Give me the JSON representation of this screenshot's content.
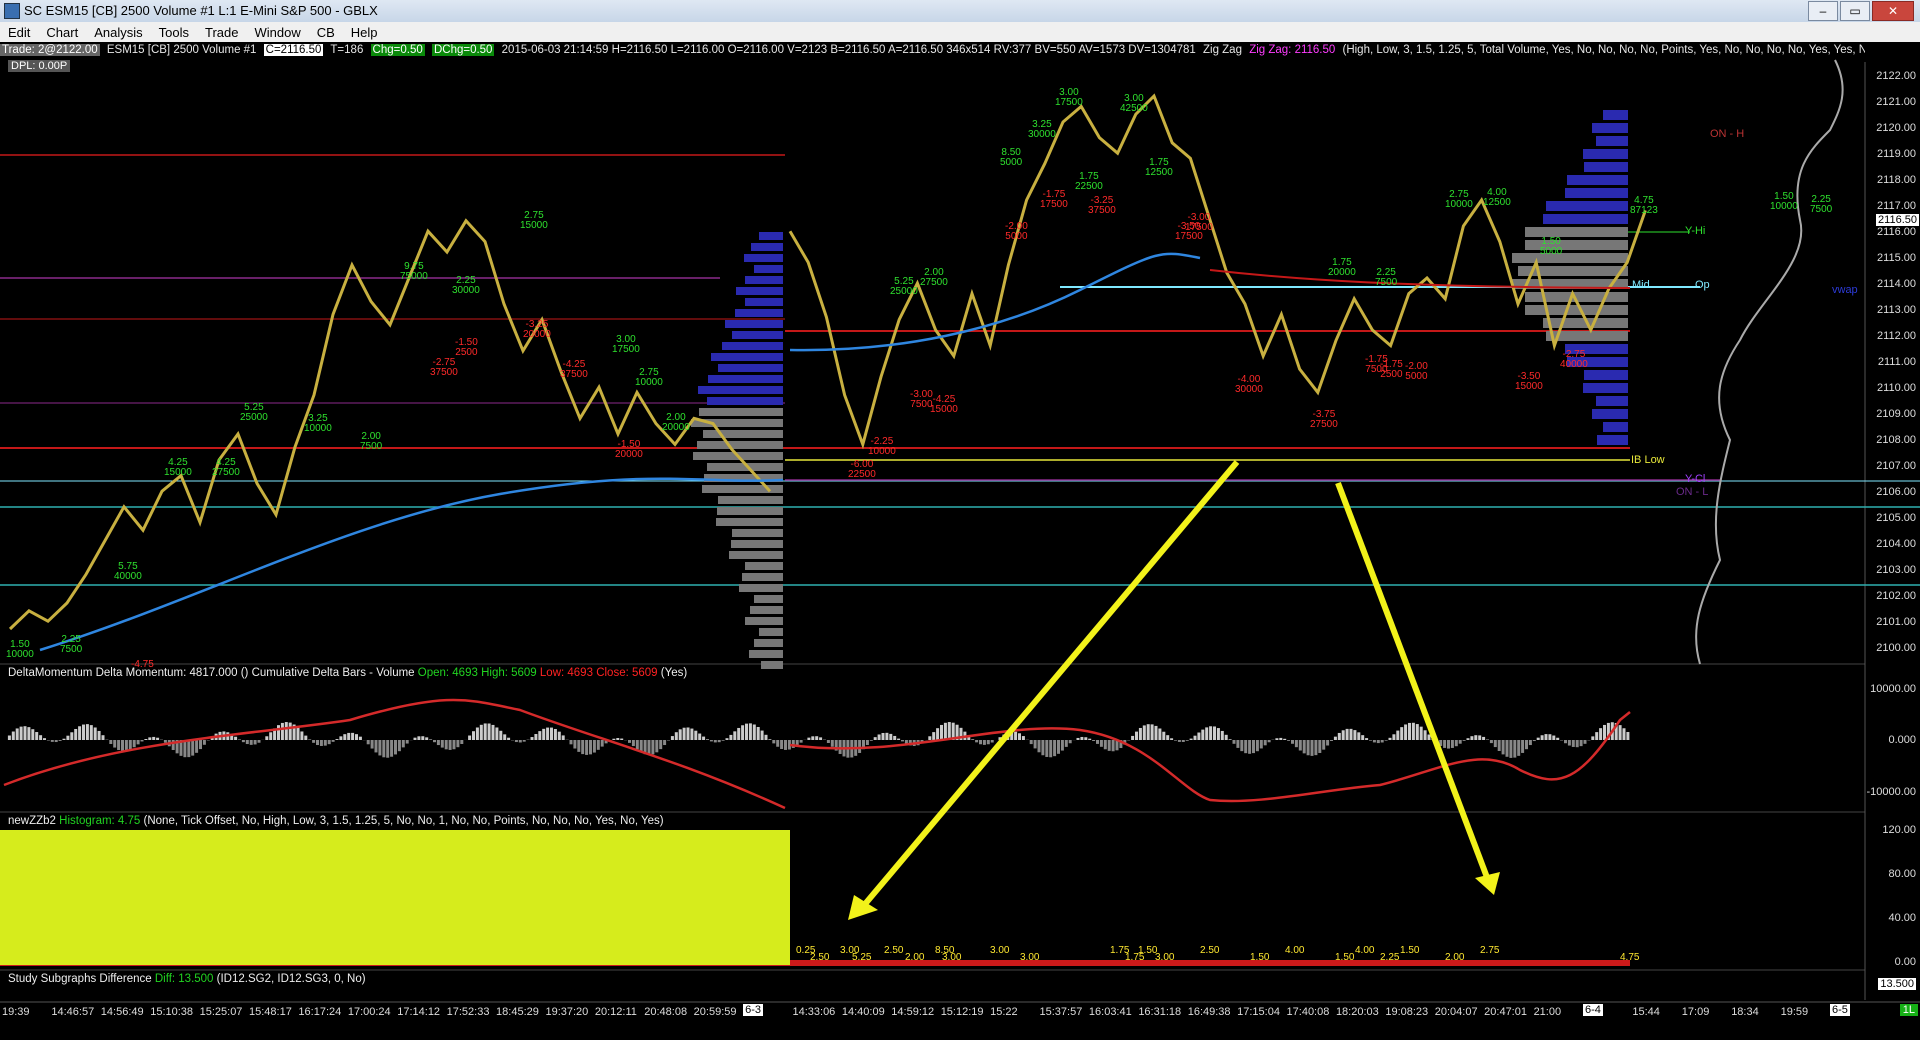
{
  "window": {
    "title": "SC ESM15 [CB]  2500 Volume  #1  L:1  E-Mini S&P 500 - GBLX",
    "controls": [
      "–",
      "▭",
      "✕"
    ]
  },
  "menu": [
    "Edit",
    "Chart",
    "Analysis",
    "Tools",
    "Trade",
    "Window",
    "CB",
    "Help"
  ],
  "infobar": {
    "trade": "Trade: 2@2122.00",
    "symbol": "ESM15 [CB]  2500 Volume  #1",
    "close": "C=2116.50",
    "ticks": "T=186",
    "chg": "Chg=0.50",
    "dchg": "DChg=0.50",
    "stats": "2015-06-03 21:14:59 H=2116.50 L=2116.00 O=2116.00 V=2123 B=2116.50 A=2116.50 346x514 RV:377 BV=550 AV=1573 DV=1304781",
    "zz1": "Zig Zag",
    "zz2": "Zig Zag: 2116.50",
    "zz3": "(High, Low, 3, 1.5, 1.25, 5, Total Volume, Yes, No, No, No, No, Points, Yes, No, No, No, No, Yes, Yes, No, Percent",
    "dpl": "DPL: 0.00P"
  },
  "price_axis": {
    "labels": [
      "2122.00",
      "2121.00",
      "2120.00",
      "2119.00",
      "2118.00",
      "2117.00",
      "2116.00",
      "2115.00",
      "2114.00",
      "2113.00",
      "2112.00",
      "2111.00",
      "2110.00",
      "2109.00",
      "2108.00",
      "2107.00",
      "2106.00",
      "2105.00",
      "2104.00",
      "2103.00",
      "2102.00",
      "2101.00",
      "2100.00"
    ],
    "current_price": "2116.50"
  },
  "levels": {
    "on_h": "ON - H",
    "y_hi": "Y-Hi",
    "mid": "Mid",
    "op": "Op",
    "ib_low": "IB Low",
    "y_cl": "Y-Cl",
    "on_l": "ON - L",
    "vwap": "vwap"
  },
  "delta_panel": {
    "name": "DeltaMomentum",
    "value": "Delta Momentum: 4817.000",
    "paren": "()",
    "cum": "Cumulative Delta Bars - Volume",
    "open": "Open: 4693",
    "high": "High: 5609",
    "low": "Low: 4693",
    "close": "Close: 5609",
    "yes": "(Yes)",
    "axis": [
      "10000.00",
      "0.000",
      "-10000.00"
    ]
  },
  "zz_panel": {
    "name": "newZZb2",
    "hist": "Histogram: 4.75",
    "params": "(None, Tick Offset, No, High, Low, 3, 1.5, 1.25, 5, No, No, 1, No, No, Points, No, No, No, Yes, No, Yes)",
    "axis": [
      "120.00",
      "80.00",
      "40.00",
      "0.00"
    ]
  },
  "diff_panel": {
    "name": "Study Subgraphs Difference",
    "diff": "Diff: 13.500",
    "params": "(ID12.SG2, ID12.SG3, 0, No)",
    "value": "13.500"
  },
  "time_axis": [
    "19:39",
    "14:46:57",
    "14:56:49",
    "15:10:38",
    "15:25:07",
    "15:48:17",
    "16:17:24",
    "17:00:24",
    "17:14:12",
    "17:52:33",
    "18:45:29",
    "19:37:20",
    "20:12:11",
    "20:48:08",
    "20:59:59",
    "6-3",
    "14:33:06",
    "14:40:09",
    "14:59:12",
    "15:12:19",
    "15:22",
    "15:37:57",
    "16:03:41",
    "16:31:18",
    "16:49:38",
    "17:15:04",
    "17:40:08",
    "18:20:03",
    "19:08:23",
    "20:04:07",
    "20:47:01",
    "21:00",
    "6-4",
    "15:44",
    "17:09",
    "18:34",
    "19:59",
    "6-5"
  ],
  "status": "1L",
  "zigzag_labels": [
    {
      "a": "3.00",
      "b": "17500",
      "c": "green"
    },
    {
      "a": "3.00",
      "b": "42500",
      "c": "green"
    },
    {
      "a": "8.50",
      "b": "5000",
      "c": "green"
    },
    {
      "a": "1.75",
      "b": "12500",
      "c": "green"
    },
    {
      "a": "3.25",
      "b": "30000",
      "c": "green"
    },
    {
      "a": "2.75",
      "b": "15000",
      "c": "green"
    },
    {
      "a": "9.75",
      "b": "75000",
      "c": "green"
    },
    {
      "a": "2.25",
      "b": "30000",
      "c": "green"
    },
    {
      "a": "1.75",
      "b": "22500",
      "c": "green"
    },
    {
      "a": "3.00",
      "b": "17500",
      "c": "green"
    },
    {
      "a": "2.75",
      "b": "10000",
      "c": "green"
    },
    {
      "a": "2.00",
      "b": "20000",
      "c": "green"
    },
    {
      "a": "5.25",
      "b": "25000",
      "c": "green"
    },
    {
      "a": "3.25",
      "b": "10000",
      "c": "green"
    },
    {
      "a": "2.00",
      "b": "7500",
      "c": "green"
    },
    {
      "a": "4.25",
      "b": "15000",
      "c": "green"
    },
    {
      "a": "4.25",
      "b": "27500",
      "c": "green"
    },
    {
      "a": "5.75",
      "b": "40000",
      "c": "green"
    },
    {
      "a": "1.50",
      "b": "10000",
      "c": "green"
    },
    {
      "a": "2.25",
      "b": "7500",
      "c": "green"
    },
    {
      "a": "5.25",
      "b": "25000",
      "c": "green"
    },
    {
      "a": "2.00",
      "b": "27500",
      "c": "green"
    },
    {
      "a": "1.50",
      "b": "10000",
      "c": "green"
    },
    {
      "a": "2.25",
      "b": "7500",
      "c": "green"
    },
    {
      "a": "2.75",
      "b": "10000",
      "c": "green"
    },
    {
      "a": "4.00",
      "b": "12500",
      "c": "green"
    },
    {
      "a": "2.25",
      "b": "7500",
      "c": "green"
    },
    {
      "a": "1.75",
      "b": "20000",
      "c": "green"
    },
    {
      "a": "1.50",
      "b": "5000",
      "c": "green"
    },
    {
      "a": "4.75",
      "b": "87123",
      "c": "green"
    },
    {
      "a": "-1.75",
      "b": "17500",
      "c": "red"
    },
    {
      "a": "-3.25",
      "b": "37500",
      "c": "red"
    },
    {
      "a": "-2.00",
      "b": "5000",
      "c": "red"
    },
    {
      "a": "-3.00",
      "b": "17500",
      "c": "red"
    },
    {
      "a": "-2.75",
      "b": "37500",
      "c": "red"
    },
    {
      "a": "-1.50",
      "b": "2500",
      "c": "red"
    },
    {
      "a": "-3.25",
      "b": "20000",
      "c": "red"
    },
    {
      "a": "-4.25",
      "b": "37500",
      "c": "red"
    },
    {
      "a": "-1.50",
      "b": "20000",
      "c": "red"
    },
    {
      "a": "-2.25",
      "b": "10000",
      "c": "red"
    },
    {
      "a": "-6.00",
      "b": "22500",
      "c": "red"
    },
    {
      "a": "-4.25",
      "b": "15000",
      "c": "red"
    },
    {
      "a": "-3.00",
      "b": "7500",
      "c": "red"
    },
    {
      "a": "-4.00",
      "b": "30000",
      "c": "red"
    },
    {
      "a": "-3.75",
      "b": "27500",
      "c": "red"
    },
    {
      "a": "-1.75",
      "b": "7500",
      "c": "red"
    },
    {
      "a": "-2.00",
      "b": "5000",
      "c": "red"
    },
    {
      "a": "-3.50",
      "b": "15000",
      "c": "red"
    },
    {
      "a": "-2.75",
      "b": "40000",
      "c": "red"
    },
    {
      "a": "-3.50",
      "b": "17500",
      "c": "red"
    },
    {
      "a": "-1.75",
      "b": "2500",
      "c": "red"
    },
    {
      "a": "-4.75",
      "b": "",
      "c": "red"
    }
  ],
  "hist_labels": [
    "0.25",
    "2.50",
    "3.00",
    "5.25",
    "2.50",
    "2.00",
    "8.50",
    "3.00",
    "3.00",
    "3.00",
    "1.75",
    "1.75",
    "1.50",
    "3.00",
    "2.50",
    "1.50",
    "4.00",
    "1.50",
    "4.00",
    "2.25",
    "1.50",
    "2.00",
    "2.75",
    "4.75"
  ]
}
